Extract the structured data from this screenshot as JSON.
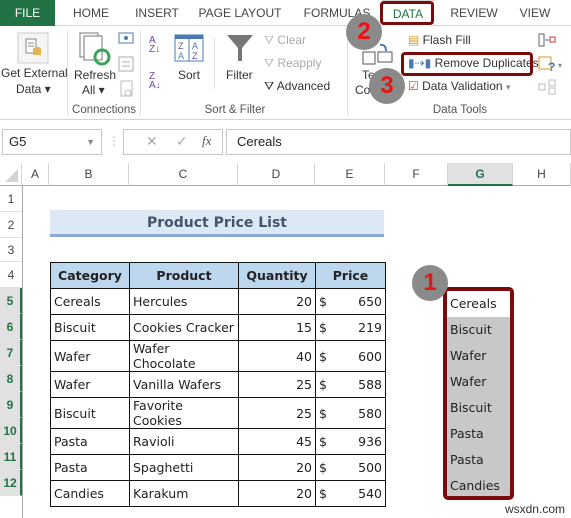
{
  "tabs": [
    {
      "label": "FILE"
    },
    {
      "label": "HOME"
    },
    {
      "label": "INSERT"
    },
    {
      "label": "PAGE LAYOUT"
    },
    {
      "label": "FORMULAS"
    },
    {
      "label": "DATA",
      "active": true
    },
    {
      "label": "REVIEW"
    },
    {
      "label": "VIEW"
    }
  ],
  "ribbon": {
    "get_external_data": {
      "line1": "Get External",
      "line2": "Data ▾"
    },
    "connections": {
      "refresh_line1": "Refresh",
      "refresh_line2": "All ▾",
      "group_label": "Connections"
    },
    "sort_filter": {
      "sort": "Sort",
      "filter": "Filter",
      "clear": "Clear",
      "reapply": "Reapply",
      "advanced": "Advanced",
      "group_label": "Sort & Filter"
    },
    "data_tools": {
      "text_to_columns_line1": "Text to",
      "text_to_columns_line2": "Columns",
      "flash_fill": "Flash Fill",
      "remove_duplicates": "Remove Duplicates",
      "data_validation": "Data Validation",
      "group_label": "Data Tools"
    }
  },
  "callouts": {
    "one": "1",
    "two": "2",
    "three": "3"
  },
  "formula_bar": {
    "name_box": "G5",
    "fx": "fx",
    "value": "Cereals"
  },
  "columns": [
    "A",
    "B",
    "C",
    "D",
    "E",
    "F",
    "G",
    "H"
  ],
  "selected_column": "G",
  "rows": [
    "1",
    "2",
    "3",
    "4",
    "5",
    "6",
    "7",
    "8",
    "9",
    "10",
    "11",
    "12"
  ],
  "sheet": {
    "title": "Product Price List",
    "headers": [
      "Category",
      "Product",
      "Quantity",
      "Price"
    ],
    "data": [
      {
        "category": "Cereals",
        "product": "Hercules",
        "quantity": "20",
        "currency": "$",
        "price": "650"
      },
      {
        "category": "Biscuit",
        "product": "Cookies Cracker",
        "quantity": "15",
        "currency": "$",
        "price": "219"
      },
      {
        "category": "Wafer",
        "product": "Wafer Chocolate",
        "quantity": "40",
        "currency": "$",
        "price": "600"
      },
      {
        "category": "Wafer",
        "product": "Vanilla Wafers",
        "quantity": "25",
        "currency": "$",
        "price": "588"
      },
      {
        "category": "Biscuit",
        "product": "Favorite Cookies",
        "quantity": "25",
        "currency": "$",
        "price": "580"
      },
      {
        "category": "Pasta",
        "product": "Ravioli",
        "quantity": "45",
        "currency": "$",
        "price": "936"
      },
      {
        "category": "Pasta",
        "product": "Spaghetti",
        "quantity": "20",
        "currency": "$",
        "price": "500"
      },
      {
        "category": "Candies",
        "product": "Karakum",
        "quantity": "20",
        "currency": "$",
        "price": "540"
      }
    ],
    "column_g": [
      "Cereals",
      "Biscuit",
      "Wafer",
      "Wafer",
      "Biscuit",
      "Pasta",
      "Pasta",
      "Candies"
    ]
  },
  "watermark": "wsxdn.com"
}
